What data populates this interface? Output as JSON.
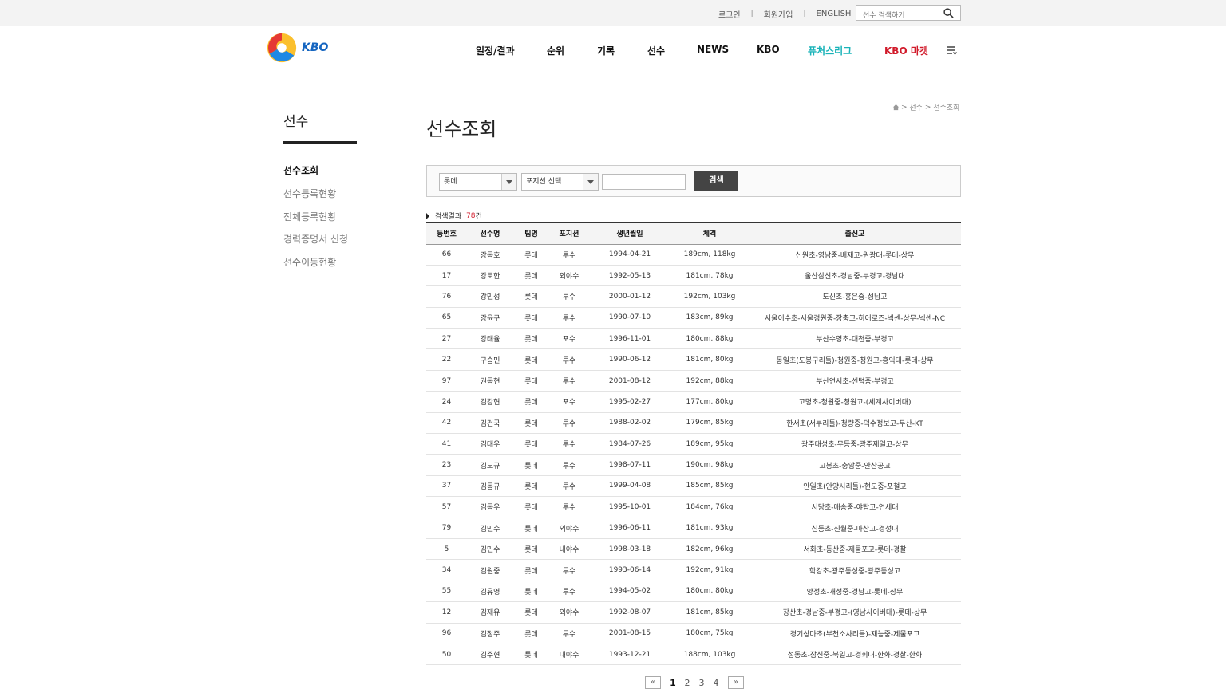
{
  "util": {
    "login": "로그인",
    "join": "회원가입",
    "english": "ENGLISH",
    "search_placeholder": "선수 검색하기"
  },
  "logo": {
    "text": "KBO"
  },
  "gnb": [
    "일정/결과",
    "순위",
    "기록",
    "선수",
    "NEWS",
    "KBO",
    "퓨처스리그",
    "KBO 마켓"
  ],
  "breadcrumb": {
    "items": [
      "선수",
      "선수조회"
    ]
  },
  "lnb": {
    "title": "선수",
    "items": [
      "선수조회",
      "선수등록현황",
      "전체등록현황",
      "경력증명서 신청",
      "선수이동현황"
    ]
  },
  "page": {
    "title": "선수조회"
  },
  "search": {
    "team_selected": "롯데",
    "position_selected": "포지션 선택",
    "name_value": "",
    "button": "검색"
  },
  "result": {
    "label": "검색결과 : ",
    "count": "78",
    "unit": "건"
  },
  "table": {
    "headers": [
      "등번호",
      "선수명",
      "팀명",
      "포지션",
      "생년월일",
      "체격",
      "출신교"
    ],
    "rows": [
      [
        "66",
        "강동호",
        "롯데",
        "투수",
        "1994-04-21",
        "189cm, 118kg",
        "신원초-영남중-배재고-원광대-롯데-상무"
      ],
      [
        "17",
        "강로한",
        "롯데",
        "외야수",
        "1992-05-13",
        "181cm, 78kg",
        "울산삼신초-경남중-부경고-경남대"
      ],
      [
        "76",
        "강민성",
        "롯데",
        "투수",
        "2000-01-12",
        "192cm, 103kg",
        "도신초-홍은중-성남고"
      ],
      [
        "65",
        "강윤구",
        "롯데",
        "투수",
        "1990-07-10",
        "183cm, 89kg",
        "서울이수초-서울경원중-장충고-히어로즈-넥센-상무-넥센-NC"
      ],
      [
        "27",
        "강태율",
        "롯데",
        "포수",
        "1996-11-01",
        "180cm, 88kg",
        "부산수영초-대천중-부경고"
      ],
      [
        "22",
        "구승민",
        "롯데",
        "투수",
        "1990-06-12",
        "181cm, 80kg",
        "동일초(도봉구리틀)-청원중-청원고-홍익대-롯데-상무"
      ],
      [
        "97",
        "권동현",
        "롯데",
        "투수",
        "2001-08-12",
        "192cm, 88kg",
        "부산연서초-센텀중-부경고"
      ],
      [
        "24",
        "김강현",
        "롯데",
        "포수",
        "1995-02-27",
        "177cm, 80kg",
        "고명초-청원중-청원고-(세계사이버대)"
      ],
      [
        "42",
        "김건국",
        "롯데",
        "투수",
        "1988-02-02",
        "179cm, 85kg",
        "한서초(서부리틀)-청량중-덕수정보고-두산-KT"
      ],
      [
        "41",
        "김대우",
        "롯데",
        "투수",
        "1984-07-26",
        "189cm, 95kg",
        "광주대성초-무등중-광주제일고-상무"
      ],
      [
        "23",
        "김도규",
        "롯데",
        "투수",
        "1998-07-11",
        "190cm, 98kg",
        "고봉초-충암중-안산공고"
      ],
      [
        "37",
        "김동규",
        "롯데",
        "투수",
        "1999-04-08",
        "185cm, 85kg",
        "안일초(안양시리틀)-현도중-포철고"
      ],
      [
        "57",
        "김동우",
        "롯데",
        "투수",
        "1995-10-01",
        "184cm, 76kg",
        "서당초-매송중-야탑고-연세대"
      ],
      [
        "79",
        "김민수",
        "롯데",
        "외야수",
        "1996-06-11",
        "181cm, 93kg",
        "신등초-신월중-마산고-경성대"
      ],
      [
        "5",
        "김민수",
        "롯데",
        "내야수",
        "1998-03-18",
        "182cm, 96kg",
        "서화초-동산중-제물포고-롯데-경찰"
      ],
      [
        "34",
        "김원중",
        "롯데",
        "투수",
        "1993-06-14",
        "192cm, 91kg",
        "학강초-광주동성중-광주동성고"
      ],
      [
        "55",
        "김유영",
        "롯데",
        "투수",
        "1994-05-02",
        "180cm, 80kg",
        "양정초-개성중-경남고-롯데-상무"
      ],
      [
        "12",
        "김재유",
        "롯데",
        "외야수",
        "1992-08-07",
        "181cm, 85kg",
        "장산초-경남중-부경고-(영남사이버대)-롯데-상무"
      ],
      [
        "96",
        "김정주",
        "롯데",
        "투수",
        "2001-08-15",
        "180cm, 75kg",
        "경기상마초(부천소사리틀)-재능중-제물포고"
      ],
      [
        "50",
        "김주현",
        "롯데",
        "내야수",
        "1993-12-21",
        "188cm, 103kg",
        "성동초-잠신중-북일고-경희대-한화-경찰-한화"
      ]
    ]
  },
  "pagination": {
    "prev": "«",
    "pages": [
      "1",
      "2",
      "3",
      "4"
    ],
    "current": "1",
    "next": "»"
  },
  "colors": {
    "accent_red": "#d11a2a",
    "futures_teal": "#19b3b8",
    "button_dark": "#444444"
  }
}
